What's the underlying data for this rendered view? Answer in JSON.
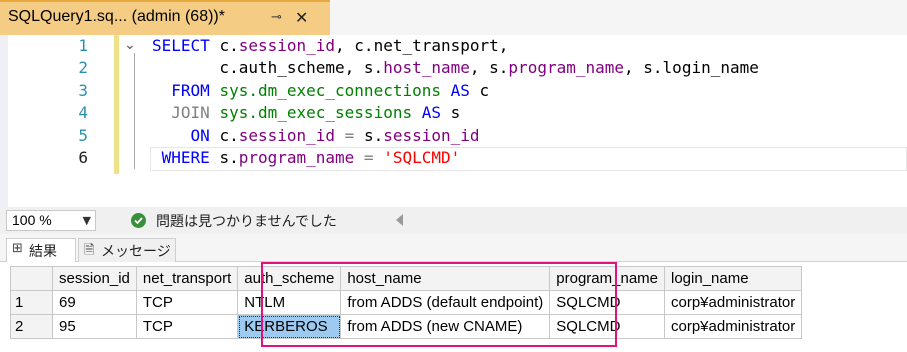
{
  "tab": {
    "title": "SQLQuery1.sq... (admin (68))*",
    "pin_glyph": "⊸",
    "close_glyph": "✕"
  },
  "editor": {
    "line_numbers": [
      "1",
      "2",
      "3",
      "4",
      "5",
      "6"
    ],
    "code_lines": [
      [
        {
          "t": "SELECT ",
          "c": "kw"
        },
        {
          "t": "c.",
          "c": "id"
        },
        {
          "t": "session_id",
          "c": "fld"
        },
        {
          "t": ", c.net_transport,",
          "c": "id"
        }
      ],
      [
        {
          "t": "       c.auth_scheme, s.",
          "c": "id"
        },
        {
          "t": "host_name",
          "c": "fld"
        },
        {
          "t": ", s.",
          "c": "id"
        },
        {
          "t": "program_name",
          "c": "fld"
        },
        {
          "t": ", s.login_name",
          "c": "id"
        }
      ],
      [
        {
          "t": "  FROM ",
          "c": "kw"
        },
        {
          "t": "sys.dm_exec_connections",
          "c": "ob"
        },
        {
          "t": " AS ",
          "c": "kw"
        },
        {
          "t": "c",
          "c": "id"
        }
      ],
      [
        {
          "t": "  JOIN ",
          "c": "gry"
        },
        {
          "t": "sys.dm_exec_sessions",
          "c": "ob"
        },
        {
          "t": " AS ",
          "c": "kw"
        },
        {
          "t": "s",
          "c": "id"
        }
      ],
      [
        {
          "t": "    ON ",
          "c": "kw"
        },
        {
          "t": "c.",
          "c": "id"
        },
        {
          "t": "session_id",
          "c": "fld"
        },
        {
          "t": " = ",
          "c": "gry"
        },
        {
          "t": "s.",
          "c": "id"
        },
        {
          "t": "session_id",
          "c": "fld"
        }
      ],
      [
        {
          "t": " WHERE ",
          "c": "kw"
        },
        {
          "t": "s.",
          "c": "id"
        },
        {
          "t": "program_name",
          "c": "fld"
        },
        {
          "t": " = ",
          "c": "gry"
        },
        {
          "t": "'SQLCMD'",
          "c": "str"
        }
      ]
    ]
  },
  "status": {
    "zoom": "100 %",
    "message": "問題は見つかりませんでした"
  },
  "result_tabs": {
    "results_label": "結果",
    "messages_label": "メッセージ"
  },
  "grid": {
    "columns": [
      "",
      "session_id",
      "net_transport",
      "auth_scheme",
      "host_name",
      "program_name",
      "login_name"
    ],
    "rows": [
      [
        "1",
        "69",
        "TCP",
        "NTLM",
        "from ADDS (default endpoint)",
        "SQLCMD",
        "corp¥administrator"
      ],
      [
        "2",
        "95",
        "TCP",
        "KERBEROS",
        "from ADDS (new CNAME)",
        "SQLCMD",
        "corp¥administrator"
      ]
    ],
    "selected_cell": [
      1,
      3
    ]
  },
  "colors": {
    "tab_active": "#f5cc84",
    "highlight_box": "#e0137a",
    "selected_cell": "#9ccaf0",
    "keyword": "#0000ff",
    "object": "#008000",
    "field": "#800080",
    "string": "#ff0000"
  }
}
